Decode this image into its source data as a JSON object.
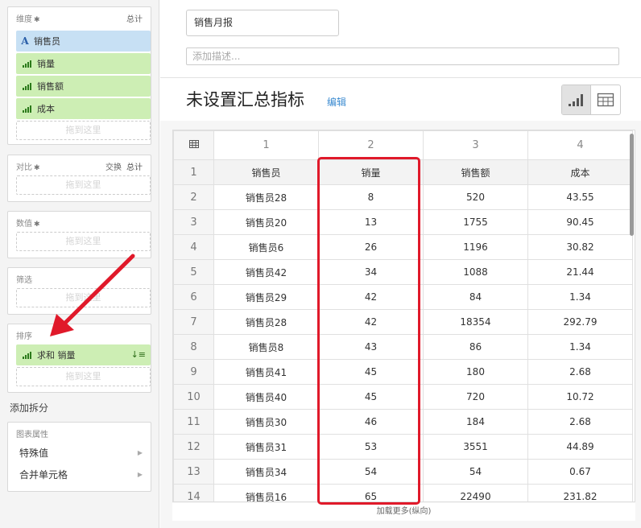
{
  "sidebar": {
    "dimensions": {
      "title": "维度",
      "total": "总计",
      "fields": [
        {
          "label": "销售员",
          "type": "text"
        },
        {
          "label": "销量",
          "type": "measure"
        },
        {
          "label": "销售额",
          "type": "measure"
        },
        {
          "label": "成本",
          "type": "measure"
        }
      ],
      "drop": "拖到这里"
    },
    "compare": {
      "title": "对比",
      "swap": "交换",
      "total": "总计",
      "drop": "拖到这里"
    },
    "values": {
      "title": "数值",
      "drop": "拖到这里"
    },
    "filter": {
      "title": "筛选",
      "drop": "拖到这里"
    },
    "sort": {
      "title": "排序",
      "field": "求和 销量",
      "drop": "拖到这里"
    },
    "add_split": "添加拆分",
    "chart_props": {
      "title": "图表属性",
      "items": [
        "特殊值",
        "合并单元格"
      ]
    }
  },
  "main": {
    "report_title": "销售月报",
    "description_placeholder": "添加描述...",
    "summary_title": "未设置汇总指标",
    "edit_label": "编辑",
    "load_more": "加载更多(纵向)"
  },
  "table": {
    "col_numbers": [
      "1",
      "2",
      "3",
      "4"
    ],
    "rows": [
      [
        "1",
        "销售员",
        "销量",
        "销售额",
        "成本"
      ],
      [
        "2",
        "销售员28",
        "8",
        "520",
        "43.55"
      ],
      [
        "3",
        "销售员20",
        "13",
        "1755",
        "90.45"
      ],
      [
        "4",
        "销售员6",
        "26",
        "1196",
        "30.82"
      ],
      [
        "5",
        "销售员42",
        "34",
        "1088",
        "21.44"
      ],
      [
        "6",
        "销售员29",
        "42",
        "84",
        "1.34"
      ],
      [
        "7",
        "销售员28",
        "42",
        "18354",
        "292.79"
      ],
      [
        "8",
        "销售员8",
        "43",
        "86",
        "1.34"
      ],
      [
        "9",
        "销售员41",
        "45",
        "180",
        "2.68"
      ],
      [
        "10",
        "销售员40",
        "45",
        "720",
        "10.72"
      ],
      [
        "11",
        "销售员30",
        "46",
        "184",
        "2.68"
      ],
      [
        "12",
        "销售员31",
        "53",
        "3551",
        "44.89"
      ],
      [
        "13",
        "销售员34",
        "54",
        "54",
        "0.67"
      ],
      [
        "14",
        "销售员16",
        "65",
        "22490",
        "231.82"
      ]
    ]
  },
  "colors": {
    "dimension": "#c7e0f4",
    "measure": "#cdeeb4",
    "highlight": "#e0192a",
    "link": "#3a8ad0"
  }
}
